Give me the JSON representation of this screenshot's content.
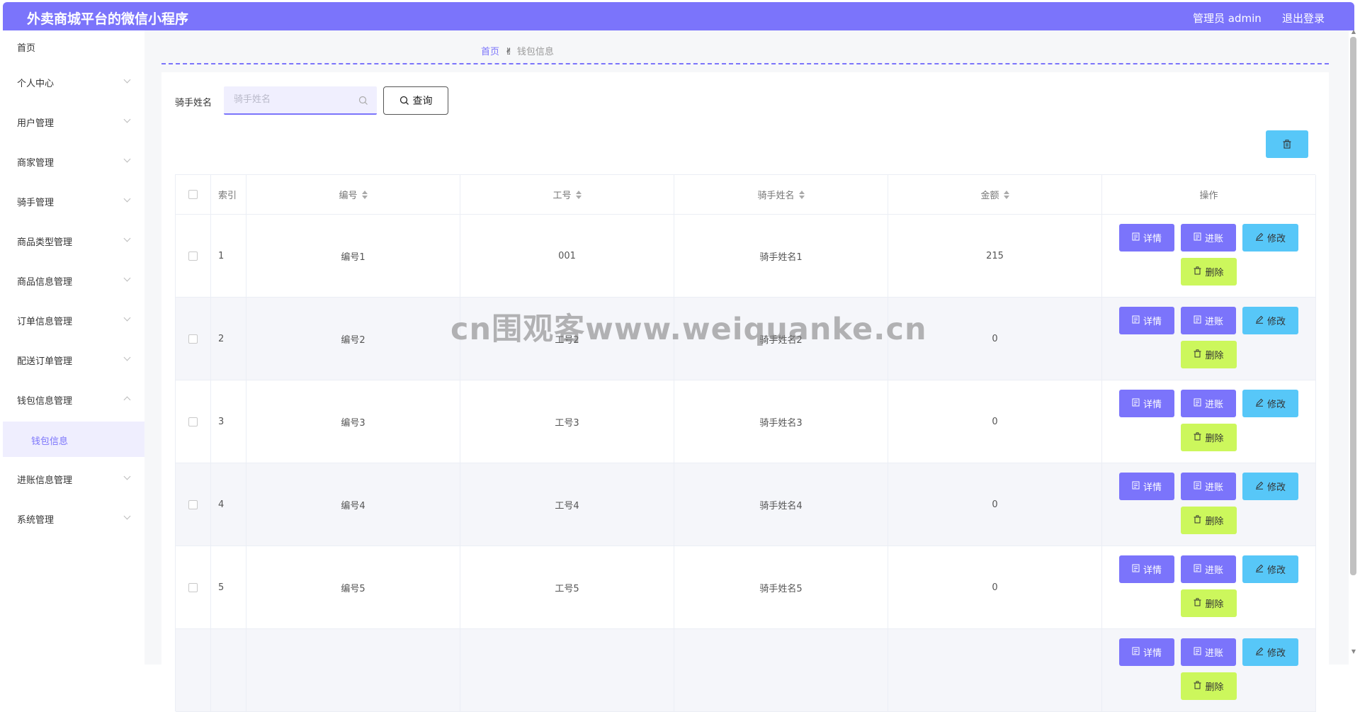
{
  "header": {
    "title": "外卖商城平台的微信小程序",
    "user": "管理员 admin",
    "logout": "退出登录"
  },
  "sidebar": {
    "items": [
      {
        "label": "首页",
        "has_children": false
      },
      {
        "label": "个人中心",
        "has_children": true
      },
      {
        "label": "用户管理",
        "has_children": true
      },
      {
        "label": "商家管理",
        "has_children": true
      },
      {
        "label": "骑手管理",
        "has_children": true
      },
      {
        "label": "商品类型管理",
        "has_children": true
      },
      {
        "label": "商品信息管理",
        "has_children": true
      },
      {
        "label": "订单信息管理",
        "has_children": true
      },
      {
        "label": "配送订单管理",
        "has_children": true
      },
      {
        "label": "钱包信息管理",
        "has_children": true,
        "expanded": true
      },
      {
        "label": "钱包信息",
        "submenu": true,
        "active": true
      },
      {
        "label": "进账信息管理",
        "has_children": true
      },
      {
        "label": "系统管理",
        "has_children": true
      }
    ]
  },
  "breadcrumb": {
    "home": "首页",
    "current": "钱包信息"
  },
  "search": {
    "label": "骑手姓名",
    "placeholder": "骑手姓名",
    "button": "查询"
  },
  "table": {
    "columns": [
      "索引",
      "编号",
      "工号",
      "骑手姓名",
      "金额",
      "操作"
    ],
    "rows": [
      {
        "index": "1",
        "code": "编号1",
        "worker_no": "001",
        "name": "骑手姓名1",
        "amount": "215"
      },
      {
        "index": "2",
        "code": "编号2",
        "worker_no": "工号2",
        "name": "骑手姓名2",
        "amount": "0"
      },
      {
        "index": "3",
        "code": "编号3",
        "worker_no": "工号3",
        "name": "骑手姓名3",
        "amount": "0"
      },
      {
        "index": "4",
        "code": "编号4",
        "worker_no": "工号4",
        "name": "骑手姓名4",
        "amount": "0"
      },
      {
        "index": "5",
        "code": "编号5",
        "worker_no": "工号5",
        "name": "骑手姓名5",
        "amount": "0"
      },
      {
        "index": "",
        "code": "",
        "worker_no": "",
        "name": "",
        "amount": ""
      }
    ],
    "actions": {
      "detail": "详情",
      "income": "进账",
      "edit": "修改",
      "delete": "删除"
    }
  },
  "watermark": "cn围观客www.weiquanke.cn",
  "colors": {
    "primary": "#7b74fb",
    "edit": "#57c7f8",
    "delete": "#ccf75c"
  }
}
